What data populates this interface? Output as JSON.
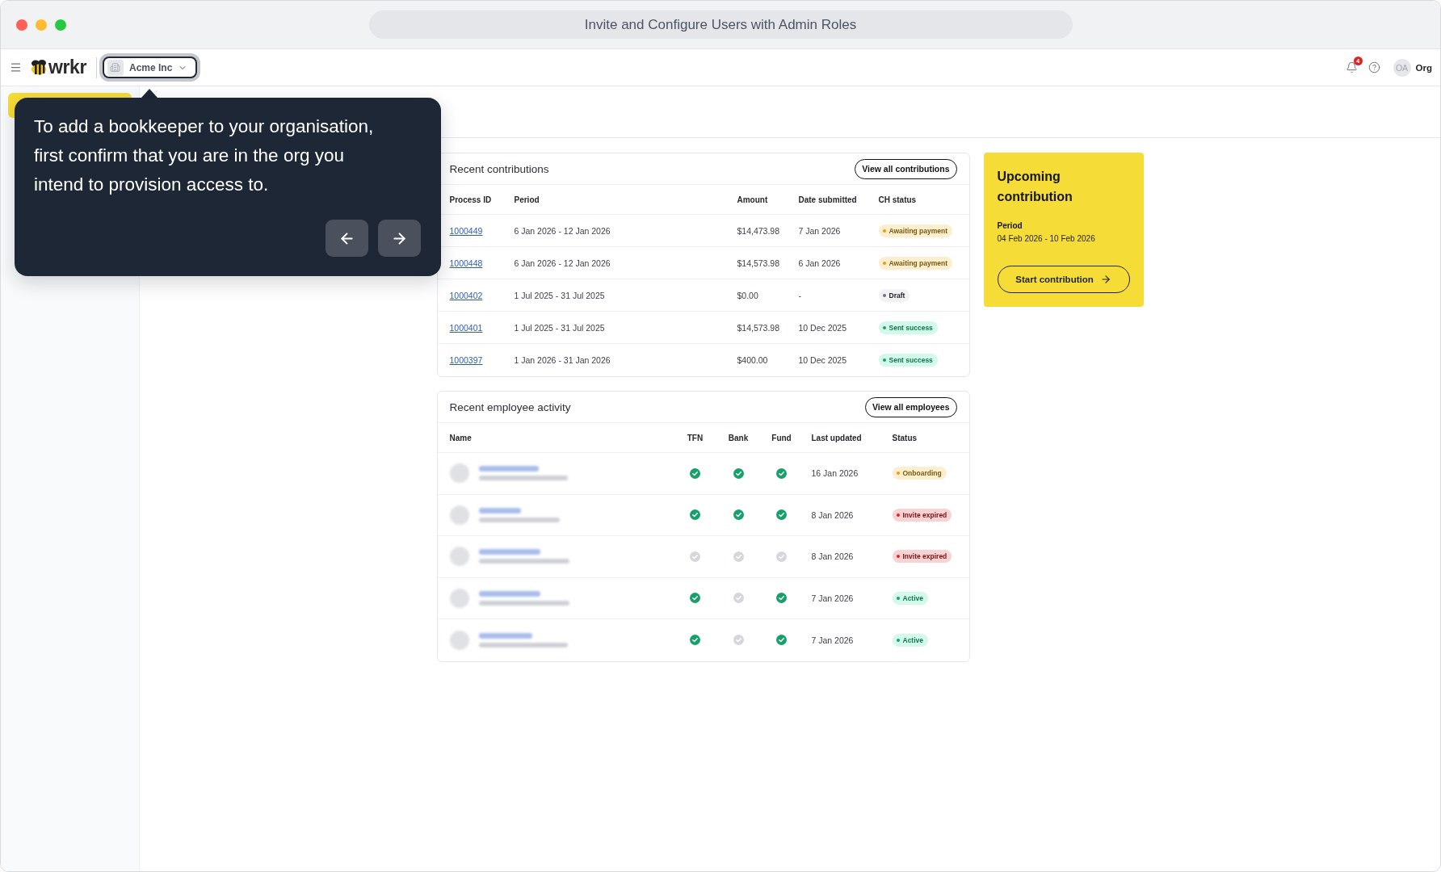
{
  "window": {
    "title": "Invite and Configure Users with Admin Roles"
  },
  "header": {
    "brand": "wrkr",
    "org_selector": {
      "label": "Acme Inc",
      "highlighted": true
    },
    "notifications": {
      "count": "4"
    },
    "avatar": {
      "initials": "OA"
    },
    "account_label": "Org"
  },
  "tour_tooltip": {
    "text": "To add a bookkeeper to your organisation, first confirm that you are in the org you intend to provision access to.",
    "buttons": [
      {
        "kind": "back"
      },
      {
        "kind": "next"
      }
    ]
  },
  "recent_contributions": {
    "title": "Recent contributions",
    "action": "View all contributions",
    "columns": [
      "Process ID",
      "Period",
      "Amount",
      "Date submitted",
      "CH status"
    ],
    "rows": [
      {
        "process_id": "1000449",
        "period": "6 Jan 2026 - 12 Jan 2026",
        "amount": "$14,473.98",
        "date_submitted": "7 Jan 2026",
        "status": {
          "label": "Awaiting payment",
          "color": "#e0a10b"
        }
      },
      {
        "process_id": "1000448",
        "period": "6 Jan 2026 - 12 Jan 2026",
        "amount": "$14,573.98",
        "date_submitted": "6 Jan 2026",
        "status": {
          "label": "Awaiting payment",
          "color": "#e0a10b"
        }
      },
      {
        "process_id": "1000402",
        "period": "1 Jul 2025 - 31 Jul 2025",
        "amount": "$0.00",
        "date_submitted": "-",
        "status": {
          "label": "Draft",
          "color": "#6b7280"
        }
      },
      {
        "process_id": "1000401",
        "period": "1 Jul 2025 - 31 Jul 2025",
        "amount": "$14,573.98",
        "date_submitted": "10 Dec 2025",
        "status": {
          "label": "Sent success",
          "color": "#16a36b"
        }
      },
      {
        "process_id": "1000397",
        "period": "1 Jan 2026 - 31 Jan 2026",
        "amount": "$400.00",
        "date_submitted": "10 Dec 2025",
        "status": {
          "label": "Sent success",
          "color": "#16a36b"
        }
      }
    ]
  },
  "recent_employee_activity": {
    "title": "Recent employee activity",
    "action": "View all employees",
    "columns": [
      "Name",
      "TFN",
      "Bank",
      "Fund",
      "Last updated",
      "Status"
    ],
    "rows": [
      {
        "tfn": true,
        "bank": true,
        "fund": true,
        "last_updated": "16 Jan 2026",
        "status": {
          "label": "Onboarding",
          "color": "#e0a10b"
        }
      },
      {
        "tfn": true,
        "bank": true,
        "fund": true,
        "last_updated": "8 Jan 2026",
        "status": {
          "label": "Invite expired",
          "color": "#dc2626"
        }
      },
      {
        "tfn": false,
        "bank": false,
        "fund": false,
        "last_updated": "8 Jan 2026",
        "status": {
          "label": "Invite expired",
          "color": "#dc2626"
        }
      },
      {
        "tfn": true,
        "bank": false,
        "fund": true,
        "last_updated": "7 Jan 2026",
        "status": {
          "label": "Active",
          "color": "#16a36b"
        }
      },
      {
        "tfn": true,
        "bank": false,
        "fund": true,
        "last_updated": "7 Jan 2026",
        "status": {
          "label": "Active",
          "color": "#16a36b"
        }
      }
    ]
  },
  "upcoming_contribution": {
    "title": "Upcoming contribution",
    "period_label": "Period",
    "period": "04 Feb 2026 - 10 Feb 2026",
    "button": "Start contribution"
  }
}
